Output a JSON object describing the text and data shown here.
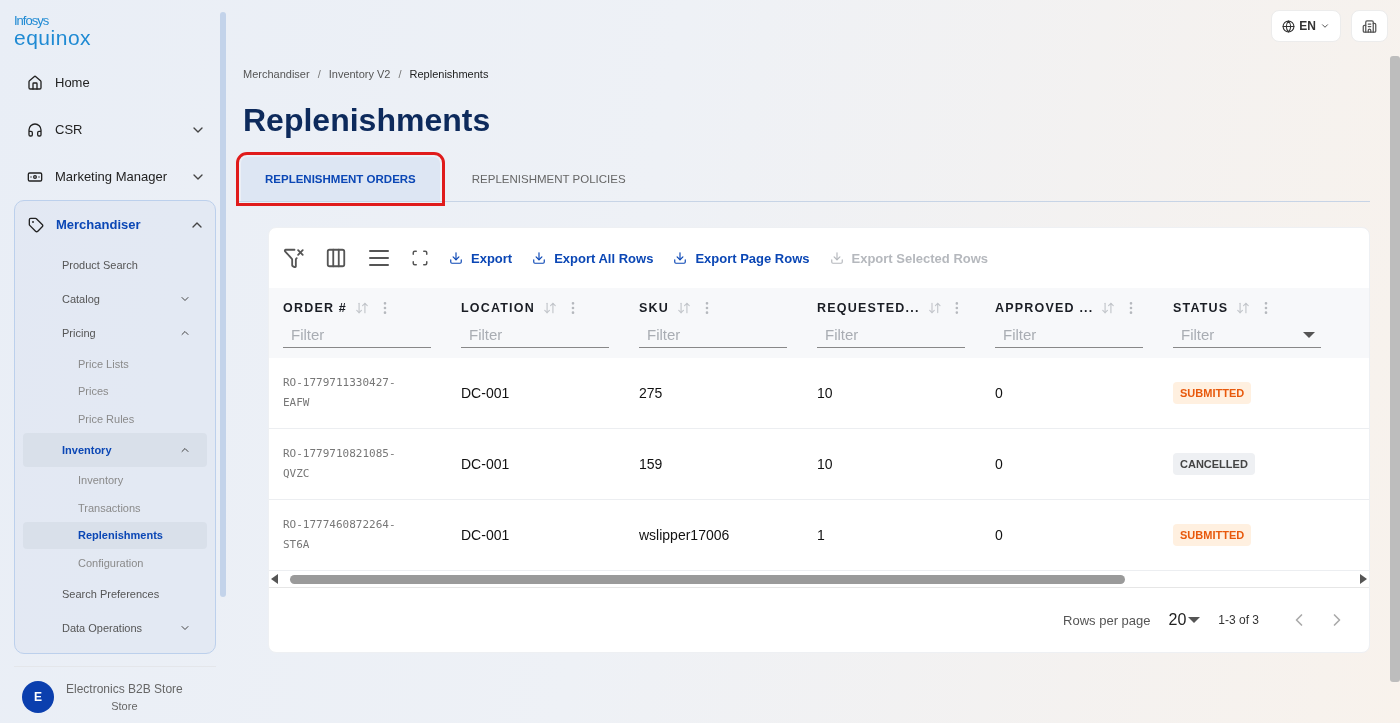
{
  "logo": {
    "top": "Infosys",
    "bottom": "equinox"
  },
  "nav": [
    {
      "label": "Home",
      "selected": false
    },
    {
      "label": "CSR",
      "selected": false,
      "expanded": false
    },
    {
      "label": "Marketing Manager",
      "selected": false,
      "expanded": false
    },
    {
      "label": "Merchandiser",
      "selected": true,
      "expanded": true,
      "children": [
        {
          "label": "Product Search",
          "selected": false
        },
        {
          "label": "Catalog",
          "selected": false,
          "expanded": false
        },
        {
          "label": "Pricing",
          "selected": false,
          "expanded": true,
          "children": [
            {
              "label": "Price Lists",
              "selected": false
            },
            {
              "label": "Prices",
              "selected": false
            },
            {
              "label": "Price Rules",
              "selected": false
            }
          ]
        },
        {
          "label": "Inventory",
          "selected": true,
          "expanded": true,
          "children": [
            {
              "label": "Inventory",
              "selected": false
            },
            {
              "label": "Transactions",
              "selected": false
            },
            {
              "label": "Replenishments",
              "selected": true
            },
            {
              "label": "Configuration",
              "selected": false
            }
          ]
        },
        {
          "label": "Search Preferences",
          "selected": false
        },
        {
          "label": "Data Operations",
          "selected": false,
          "expanded": false
        }
      ]
    }
  ],
  "store": {
    "initial": "E",
    "name": "Electronics B2B Store",
    "type": "Store"
  },
  "language": "EN",
  "breadcrumbs": [
    "Merchandiser",
    "Inventory V2",
    "Replenishments"
  ],
  "breadcrumb_separator": "/",
  "title": "Replenishments",
  "tabs": [
    {
      "label": "REPLENISHMENT ORDERS",
      "selected": true,
      "highlighted": true
    },
    {
      "label": "REPLENISHMENT POLICIES",
      "selected": false,
      "highlighted": false
    }
  ],
  "actions": [
    {
      "label": "Export",
      "disabled": false
    },
    {
      "label": "Export All Rows",
      "disabled": false
    },
    {
      "label": "Export Page Rows",
      "disabled": false
    },
    {
      "label": "Export Selected Rows",
      "disabled": true
    }
  ],
  "columns": [
    {
      "label": "ORDER #",
      "placeholder": "Filter",
      "kind": "text"
    },
    {
      "label": "LOCATION",
      "placeholder": "Filter",
      "kind": "text"
    },
    {
      "label": "SKU",
      "placeholder": "Filter",
      "kind": "text"
    },
    {
      "label": "REQUESTED...",
      "placeholder": "Filter",
      "kind": "text"
    },
    {
      "label": "APPROVED ...",
      "placeholder": "Filter",
      "kind": "text"
    },
    {
      "label": "STATUS",
      "placeholder": "Filter",
      "kind": "select"
    }
  ],
  "rows": [
    {
      "order": [
        "RO-1779711330427-",
        "EAFW"
      ],
      "location": "DC-001",
      "sku": "275",
      "requested": "10",
      "approved": "0",
      "status": {
        "label": "SUBMITTED",
        "kind": "submitted"
      }
    },
    {
      "order": [
        "RO-1779710821085-",
        "QVZC"
      ],
      "location": "DC-001",
      "sku": "159",
      "requested": "10",
      "approved": "0",
      "status": {
        "label": "CANCELLED",
        "kind": "cancelled"
      }
    },
    {
      "order": [
        "RO-1777460872264-",
        "ST6A"
      ],
      "location": "DC-001",
      "sku": "wslipper17006",
      "requested": "1",
      "approved": "0",
      "status": {
        "label": "SUBMITTED",
        "kind": "submitted"
      }
    }
  ],
  "pagination": {
    "label": "Rows per page",
    "value": "20",
    "range": "1-3 of 3"
  }
}
